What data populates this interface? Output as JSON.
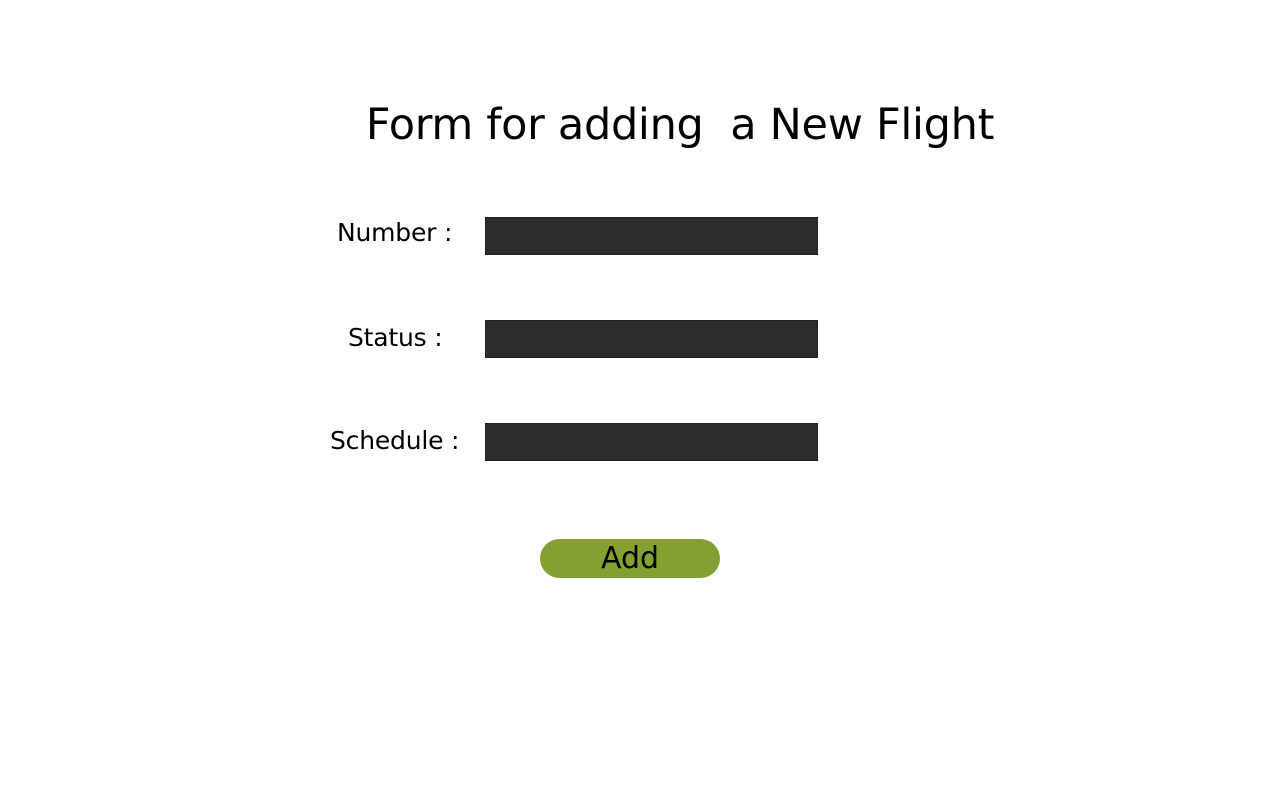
{
  "form": {
    "title": "Form for adding  a New Flight",
    "fields": {
      "number": {
        "label": "Number :",
        "value": "",
        "placeholder": ""
      },
      "status": {
        "label": "Status :",
        "value": "",
        "placeholder": ""
      },
      "schedule": {
        "label": "Schedule :",
        "value": "",
        "placeholder": ""
      }
    },
    "submit_label": "Add"
  },
  "colors": {
    "background": "#ffffff",
    "input_fill": "#2c2c2c",
    "button_fill": "#85a032",
    "text": "#000000"
  }
}
